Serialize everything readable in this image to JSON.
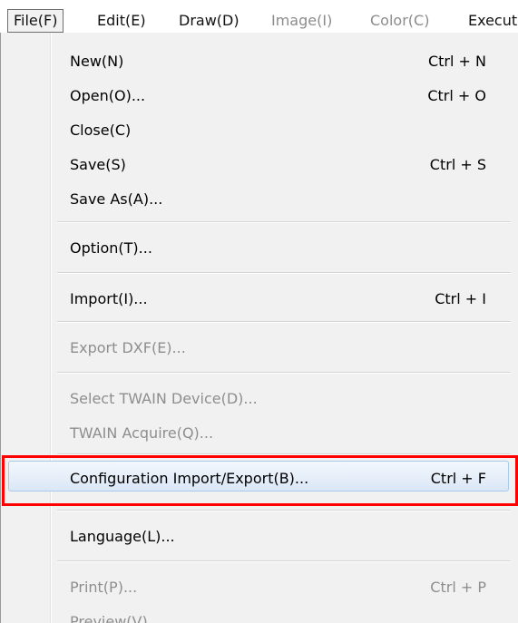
{
  "menubar": {
    "items": [
      {
        "label": "File(F)",
        "state": "active"
      },
      {
        "label": "Edit(E)",
        "state": "enabled"
      },
      {
        "label": "Draw(D)",
        "state": "enabled"
      },
      {
        "label": "Image(I)",
        "state": "disabled"
      },
      {
        "label": "Color(C)",
        "state": "disabled"
      },
      {
        "label": "Execut",
        "state": "enabled"
      }
    ]
  },
  "file_menu": {
    "items": [
      {
        "label": "New(N)",
        "shortcut": "Ctrl + N",
        "enabled": true
      },
      {
        "label": "Open(O)...",
        "shortcut": "Ctrl + O",
        "enabled": true
      },
      {
        "label": "Close(C)",
        "shortcut": "",
        "enabled": true
      },
      {
        "label": "Save(S)",
        "shortcut": "Ctrl + S",
        "enabled": true
      },
      {
        "label": "Save As(A)...",
        "shortcut": "",
        "enabled": true
      },
      {
        "label": "Option(T)...",
        "shortcut": "",
        "enabled": true
      },
      {
        "label": "Import(I)...",
        "shortcut": "Ctrl + I",
        "enabled": true
      },
      {
        "label": "Export DXF(E)...",
        "shortcut": "",
        "enabled": false
      },
      {
        "label": "Select TWAIN Device(D)...",
        "shortcut": "",
        "enabled": false
      },
      {
        "label": "TWAIN Acquire(Q)...",
        "shortcut": "",
        "enabled": false
      },
      {
        "label": "Configuration Import/Export(B)...",
        "shortcut": "Ctrl + F",
        "enabled": true,
        "highlighted": true
      },
      {
        "label": "Language(L)...",
        "shortcut": "",
        "enabled": true
      },
      {
        "label": "Print(P)...",
        "shortcut": "Ctrl + P",
        "enabled": false
      },
      {
        "label": "Preview(V)",
        "shortcut": "",
        "enabled": false
      }
    ]
  },
  "colors": {
    "callout": "#ff0000",
    "highlight": "#dbe7f6",
    "disabled_text": "#8e8e8e"
  }
}
